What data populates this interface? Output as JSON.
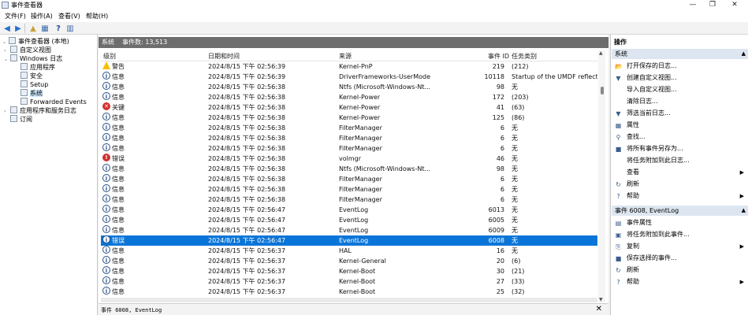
{
  "window": {
    "title": "事件查看器"
  },
  "menu": [
    "文件(F)",
    "操作(A)",
    "查看(V)",
    "帮助(H)"
  ],
  "tree": {
    "root": "事件查看器 (本地)",
    "items": [
      {
        "label": "自定义视图",
        "level": 1,
        "exp": "›"
      },
      {
        "label": "Windows 日志",
        "level": 1,
        "exp": "⌄"
      },
      {
        "label": "应用程序",
        "level": 2,
        "exp": ""
      },
      {
        "label": "安全",
        "level": 2,
        "exp": ""
      },
      {
        "label": "Setup",
        "level": 2,
        "exp": ""
      },
      {
        "label": "系统",
        "level": 2,
        "exp": "",
        "selected": true
      },
      {
        "label": "Forwarded Events",
        "level": 2,
        "exp": ""
      },
      {
        "label": "应用程序和服务日志",
        "level": 1,
        "exp": "›"
      },
      {
        "label": "订阅",
        "level": 1,
        "exp": ""
      }
    ]
  },
  "center": {
    "log_name": "系统",
    "event_count": "事件数: 13,513",
    "columns": {
      "level": "级别",
      "datetime": "日期和时间",
      "source": "来源",
      "event_id": "事件 ID",
      "category": "任务类别"
    },
    "rows": [
      {
        "icon": "warn",
        "level": "警告",
        "datetime": "2024/8/15 下午 02:56:39",
        "source": "Kernel-PnP",
        "id": "219",
        "cat": "(212)"
      },
      {
        "icon": "info",
        "level": "信息",
        "datetime": "2024/8/15 下午 02:56:39",
        "source": "DriverFrameworks-UserMode",
        "id": "10118",
        "cat": "Startup of the UMDF reflector"
      },
      {
        "icon": "info",
        "level": "信息",
        "datetime": "2024/8/15 下午 02:56:38",
        "source": "Ntfs (Microsoft-Windows-Nt...",
        "id": "98",
        "cat": "无"
      },
      {
        "icon": "info",
        "level": "信息",
        "datetime": "2024/8/15 下午 02:56:38",
        "source": "Kernel-Power",
        "id": "172",
        "cat": "(203)"
      },
      {
        "icon": "crit",
        "level": "关键",
        "datetime": "2024/8/15 下午 02:56:38",
        "source": "Kernel-Power",
        "id": "41",
        "cat": "(63)"
      },
      {
        "icon": "info",
        "level": "信息",
        "datetime": "2024/8/15 下午 02:56:38",
        "source": "Kernel-Power",
        "id": "125",
        "cat": "(86)"
      },
      {
        "icon": "info",
        "level": "信息",
        "datetime": "2024/8/15 下午 02:56:38",
        "source": "FilterManager",
        "id": "6",
        "cat": "无"
      },
      {
        "icon": "info",
        "level": "信息",
        "datetime": "2024/8/15 下午 02:56:38",
        "source": "FilterManager",
        "id": "6",
        "cat": "无"
      },
      {
        "icon": "info",
        "level": "信息",
        "datetime": "2024/8/15 下午 02:56:38",
        "source": "FilterManager",
        "id": "6",
        "cat": "无"
      },
      {
        "icon": "err",
        "level": "错误",
        "datetime": "2024/8/15 下午 02:56:38",
        "source": "volmgr",
        "id": "46",
        "cat": "无"
      },
      {
        "icon": "info",
        "level": "信息",
        "datetime": "2024/8/15 下午 02:56:38",
        "source": "Ntfs (Microsoft-Windows-Nt...",
        "id": "98",
        "cat": "无"
      },
      {
        "icon": "info",
        "level": "信息",
        "datetime": "2024/8/15 下午 02:56:38",
        "source": "FilterManager",
        "id": "6",
        "cat": "无"
      },
      {
        "icon": "info",
        "level": "信息",
        "datetime": "2024/8/15 下午 02:56:38",
        "source": "FilterManager",
        "id": "6",
        "cat": "无"
      },
      {
        "icon": "info",
        "level": "信息",
        "datetime": "2024/8/15 下午 02:56:38",
        "source": "FilterManager",
        "id": "6",
        "cat": "无"
      },
      {
        "icon": "info",
        "level": "信息",
        "datetime": "2024/8/15 下午 02:56:47",
        "source": "EventLog",
        "id": "6013",
        "cat": "无"
      },
      {
        "icon": "info",
        "level": "信息",
        "datetime": "2024/8/15 下午 02:56:47",
        "source": "EventLog",
        "id": "6005",
        "cat": "无"
      },
      {
        "icon": "info",
        "level": "信息",
        "datetime": "2024/8/15 下午 02:56:47",
        "source": "EventLog",
        "id": "6009",
        "cat": "无"
      },
      {
        "icon": "info",
        "level": "错误",
        "datetime": "2024/8/15 下午 02:56:47",
        "source": "EventLog",
        "id": "6008",
        "cat": "无",
        "selected": true
      },
      {
        "icon": "info",
        "level": "信息",
        "datetime": "2024/8/15 下午 02:56:37",
        "source": "HAL",
        "id": "16",
        "cat": "无"
      },
      {
        "icon": "info",
        "level": "信息",
        "datetime": "2024/8/15 下午 02:56:37",
        "source": "Kernel-General",
        "id": "20",
        "cat": "(6)"
      },
      {
        "icon": "info",
        "level": "信息",
        "datetime": "2024/8/15 下午 02:56:37",
        "source": "Kernel-Boot",
        "id": "30",
        "cat": "(21)"
      },
      {
        "icon": "info",
        "level": "信息",
        "datetime": "2024/8/15 下午 02:56:37",
        "source": "Kernel-Boot",
        "id": "27",
        "cat": "(33)"
      },
      {
        "icon": "info",
        "level": "信息",
        "datetime": "2024/8/15 下午 02:56:37",
        "source": "Kernel-Boot",
        "id": "25",
        "cat": "(32)"
      }
    ],
    "detail_title": "事件 6008, EventLog"
  },
  "actions": {
    "title": "操作",
    "section1": "系统",
    "items1": [
      {
        "icon": "open-saved-log-icon",
        "glyph": "📂",
        "label": "打开保存的日志..."
      },
      {
        "icon": "filter-icon",
        "glyph": "▼",
        "label": "创建自定义视图..."
      },
      {
        "icon": "import-view-icon",
        "glyph": "",
        "label": "导入自定义视图..."
      },
      {
        "icon": "clear-log-icon",
        "glyph": "",
        "label": "清除日志..."
      },
      {
        "icon": "filter-icon",
        "glyph": "▼",
        "label": "筛选当前日志..."
      },
      {
        "icon": "properties-icon",
        "glyph": "▦",
        "label": "属性"
      },
      {
        "icon": "find-icon",
        "glyph": "⚲",
        "label": "查找..."
      },
      {
        "icon": "save-icon",
        "glyph": "■",
        "label": "将所有事件另存为..."
      },
      {
        "icon": "attach-task-icon",
        "glyph": "",
        "label": "将任务附加到此日志..."
      },
      {
        "icon": "view-icon",
        "glyph": "",
        "label": "查看",
        "submenu": true
      },
      {
        "icon": "refresh-icon",
        "glyph": "↻",
        "label": "刷新"
      },
      {
        "icon": "help-icon",
        "glyph": "?",
        "label": "帮助",
        "submenu": true
      }
    ],
    "section2": "事件 6008, EventLog",
    "items2": [
      {
        "icon": "event-properties-icon",
        "glyph": "▤",
        "label": "事件属性"
      },
      {
        "icon": "attach-task-icon",
        "glyph": "▣",
        "label": "将任务附加到此事件..."
      },
      {
        "icon": "copy-icon",
        "glyph": "⎘",
        "label": "复制",
        "submenu": true
      },
      {
        "icon": "save-icon",
        "glyph": "■",
        "label": "保存选择的事件..."
      },
      {
        "icon": "refresh-icon",
        "glyph": "↻",
        "label": "刷新"
      },
      {
        "icon": "help-icon",
        "glyph": "?",
        "label": "帮助",
        "submenu": true
      }
    ]
  }
}
